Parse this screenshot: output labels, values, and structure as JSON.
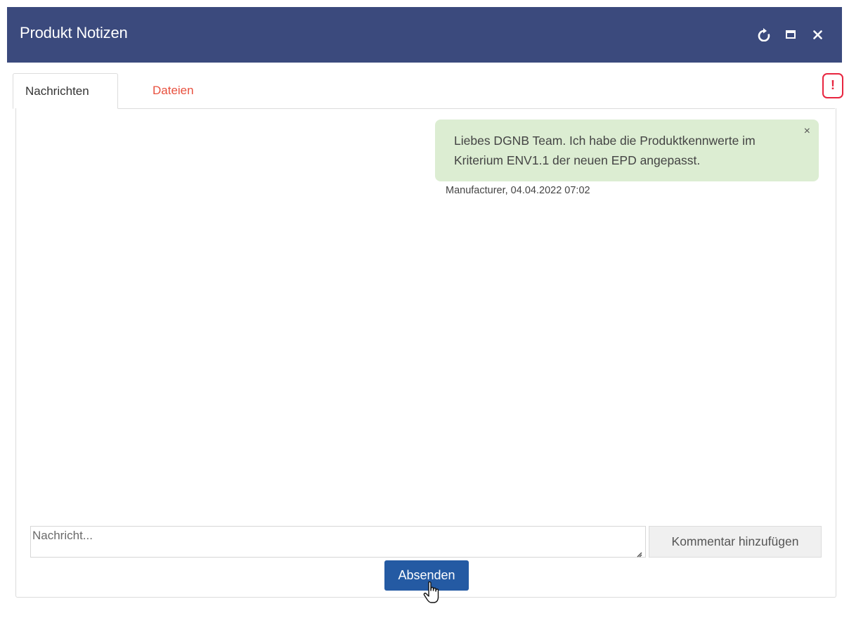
{
  "window": {
    "title": "Produkt Notizen",
    "controls": [
      "refresh-icon",
      "maximize-icon",
      "close-icon"
    ]
  },
  "tabs": [
    {
      "label": "Nachrichten",
      "active": true
    },
    {
      "label": "Dateien",
      "active": false
    }
  ],
  "alert_badge": {
    "label": "!",
    "color": "#e8253f"
  },
  "messages": [
    {
      "text": "Liebes DGNB Team. Ich habe die Produktkennwerte im Kriterium ENV1.1 der neuen EPD angepasst.",
      "meta": "Manufacturer, 04.04.2022 07:02",
      "close_symbol": "×"
    }
  ],
  "composer": {
    "placeholder": "Nachricht...",
    "addon_label": "Kommentar hinzufügen",
    "send_label": "Absenden"
  },
  "colors": {
    "titlebar": "#3b4a7d",
    "message_bubble": "#dcedd2",
    "send_button": "#245aa3",
    "inactive_tab": "#e8503e"
  }
}
